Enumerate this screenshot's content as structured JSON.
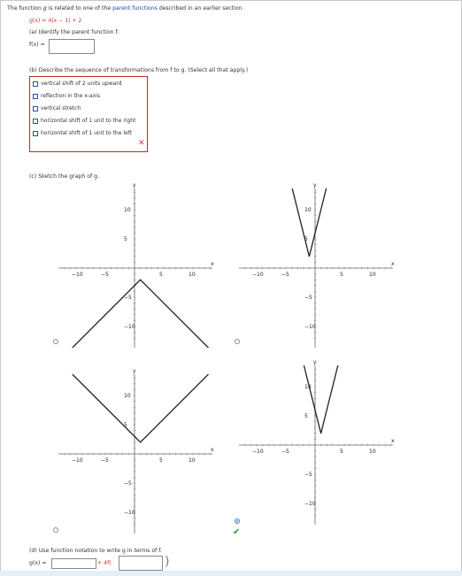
{
  "intro": {
    "prefix": "The function ",
    "g": "g",
    "mid": " is related to one of the ",
    "link": "parent functions",
    "suffix": " described in an earlier section."
  },
  "given": {
    "expr": "g(x) = 4|x − 1| + 2"
  },
  "part_a": {
    "prompt": "(a) Identify the parent function f.",
    "field_label": "f(x) =",
    "answer": ""
  },
  "part_b": {
    "prompt": "(b) Describe the sequence of transformations from f to g. (Select all that apply.)",
    "options": [
      {
        "label": "vertical shift of 2 units upward",
        "checked": false
      },
      {
        "label": "reflection in the x-axis",
        "checked": false
      },
      {
        "label": "vertical stretch",
        "checked": false
      },
      {
        "label": "horizontal shift of 1 unit to the right",
        "checked": false
      },
      {
        "label": "horizontal shift of 1 unit to the left",
        "checked": false
      }
    ],
    "status": "✕",
    "status_color": "#dd3333"
  },
  "part_c": {
    "prompt": "(c) Sketch the graph of g.",
    "axis_labels": {
      "x": "x",
      "y": "y"
    },
    "ticks": {
      "neg10": "−10",
      "neg5": "−5",
      "pos5": "5",
      "pos10": "10"
    },
    "options": [
      {
        "id": "A",
        "selected": false,
        "vertex": [
          1,
          -2
        ],
        "slope": -1
      },
      {
        "id": "B",
        "selected": false,
        "vertex": [
          -1,
          2
        ],
        "slope": 4
      },
      {
        "id": "C",
        "selected": false,
        "vertex": [
          1,
          2
        ],
        "slope": 1
      },
      {
        "id": "D",
        "selected": true,
        "vertex": [
          1,
          2
        ],
        "slope": 4
      }
    ],
    "correct_icon": "✔",
    "correct_color": "#2a9d3a"
  },
  "part_d": {
    "prompt": "(d) Use function notation to write g in terms of f.",
    "field_label": "g(x) =",
    "middle": "+ 4f(",
    "close": ")",
    "answer1": "",
    "answer2": ""
  }
}
